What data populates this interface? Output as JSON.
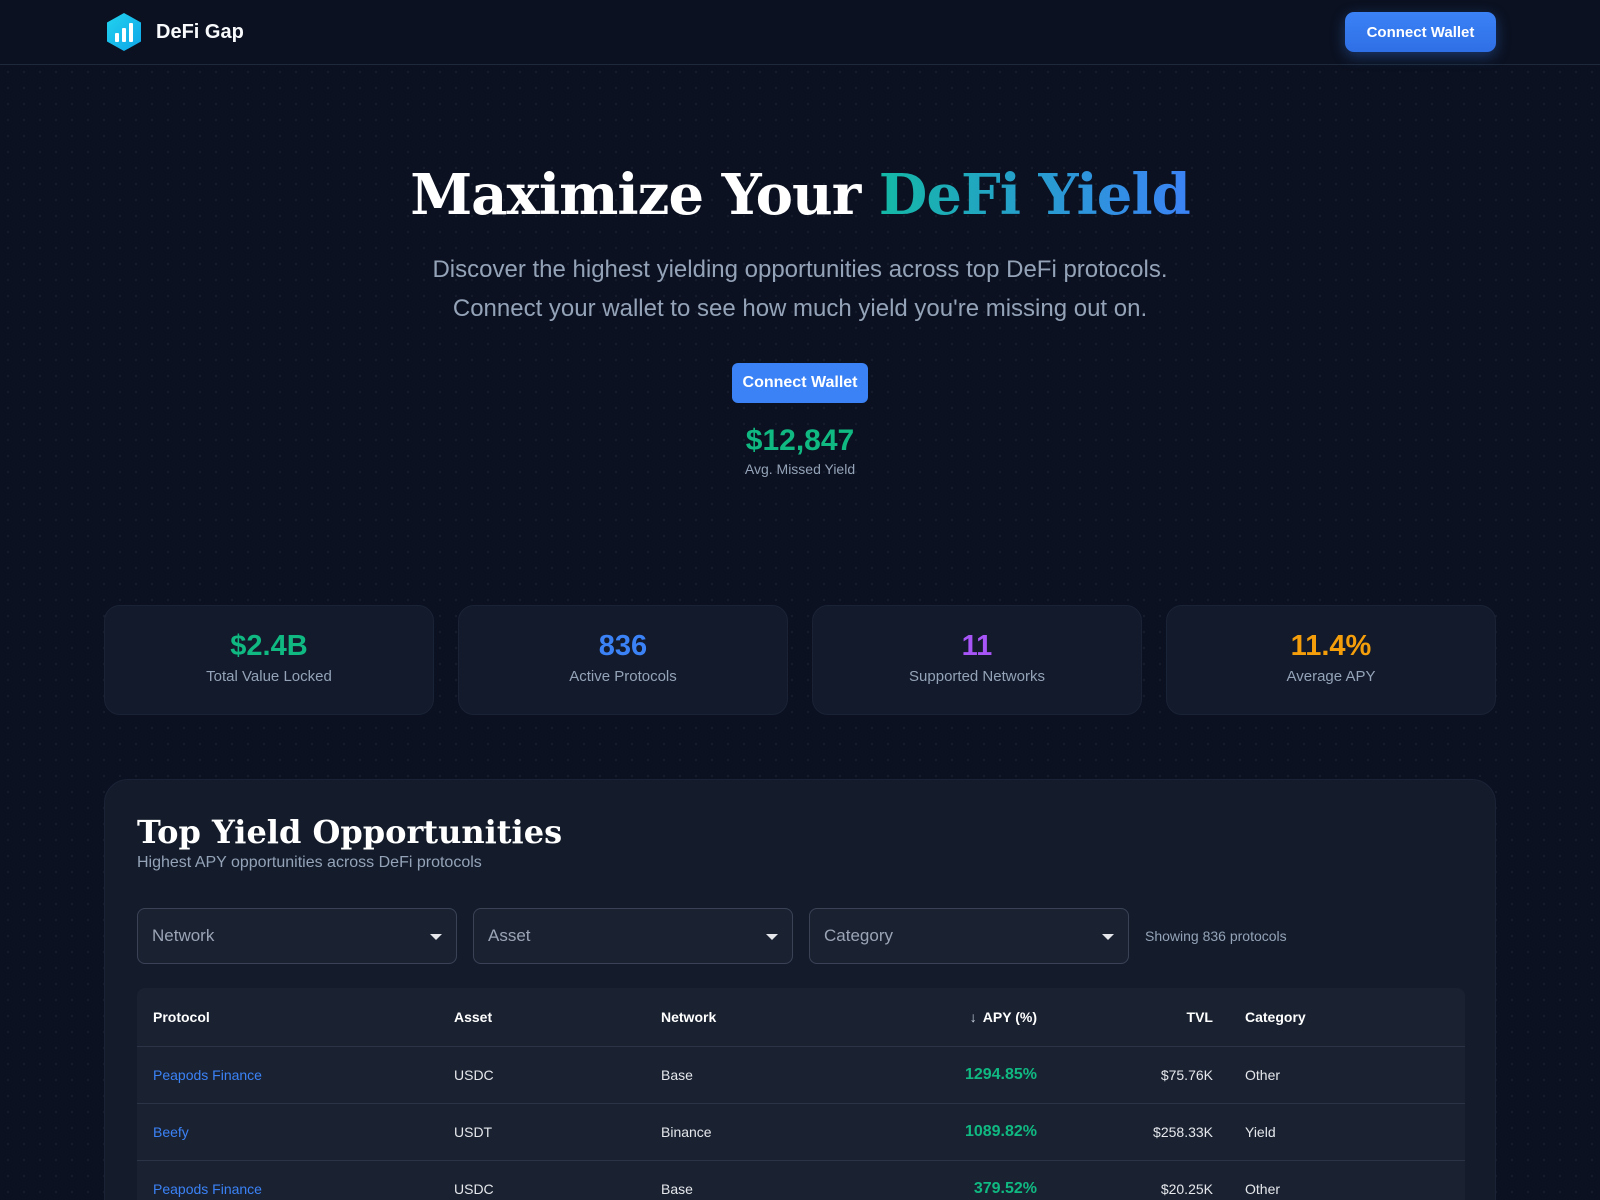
{
  "nav": {
    "brand": "DeFi Gap",
    "connect_label": "Connect Wallet"
  },
  "hero": {
    "title_main": "Maximize Your ",
    "title_accent": "DeFi Yield",
    "subtitle_line1": "Discover the highest yielding opportunities across top DeFi protocols.",
    "subtitle_line2": "Connect your wallet to see how much yield you're missing out on.",
    "connect_label": "Connect Wallet",
    "missed_value": "$12,847",
    "missed_label": "Avg. Missed Yield"
  },
  "stats": [
    {
      "value": "$2.4B",
      "label": "Total Value Locked",
      "color": "#10b981"
    },
    {
      "value": "836",
      "label": "Active Protocols",
      "color": "#3b82f6"
    },
    {
      "value": "11",
      "label": "Supported Networks",
      "color": "#a855f7"
    },
    {
      "value": "11.4%",
      "label": "Average APY",
      "color": "#f59e0b"
    }
  ],
  "opportunities": {
    "title": "Top Yield Opportunities",
    "subtitle": "Highest APY opportunities across DeFi protocols",
    "filters": {
      "network_placeholder": "Network",
      "asset_placeholder": "Asset",
      "category_placeholder": "Category",
      "showing": "Showing 836 protocols"
    },
    "columns": {
      "protocol": "Protocol",
      "asset": "Asset",
      "network": "Network",
      "apy": "APY (%)",
      "tvl": "TVL",
      "category": "Category"
    },
    "rows": [
      {
        "protocol": "Peapods Finance",
        "asset": "USDC",
        "network": "Base",
        "apy": "1294.85%",
        "tvl": "$75.76K",
        "category": "Other"
      },
      {
        "protocol": "Beefy",
        "asset": "USDT",
        "network": "Binance",
        "apy": "1089.82%",
        "tvl": "$258.33K",
        "category": "Yield"
      },
      {
        "protocol": "Peapods Finance",
        "asset": "USDC",
        "network": "Base",
        "apy": "379.52%",
        "tvl": "$20.25K",
        "category": "Other"
      }
    ]
  }
}
